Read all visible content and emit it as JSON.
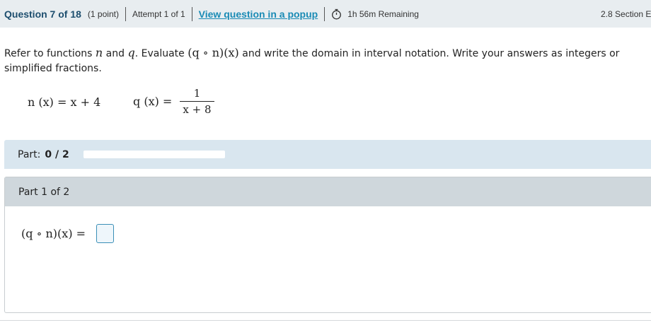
{
  "header": {
    "question_label": "Question 7 of 18",
    "points": "(1 point)",
    "attempt": "Attempt 1 of 1",
    "popup_link": "View question in a popup",
    "timer_icon": "stopwatch-icon",
    "time_remaining": "1h 56m Remaining",
    "section": "2.8 Section E"
  },
  "question": {
    "t1": "Refer to functions ",
    "v_n": "n",
    "t2": " and ",
    "v_q": "q",
    "t3": ". Evaluate ",
    "expr": "(q ∘ n)(x)",
    "t4": " and write the domain in interval notation. Write your answers as integers or simplified fractions."
  },
  "functions": {
    "n_lhs": "n (x) = ",
    "n_rhs": "x + 4",
    "q_lhs": "q (x) = ",
    "q_num": "1",
    "q_den": "x + 8"
  },
  "progress": {
    "label": "Part:",
    "value": "0 / 2",
    "fraction": 0
  },
  "part1": {
    "title": "Part 1 of 2",
    "answer_label": "(q ∘ n)(x) = "
  }
}
